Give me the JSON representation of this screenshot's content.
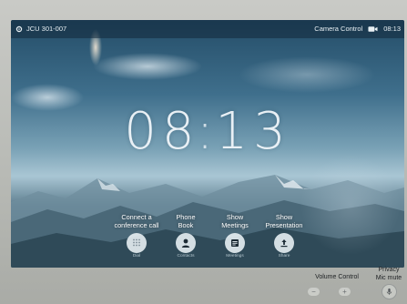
{
  "topbar": {
    "room_name": "JCU 301-007",
    "camera_control_label": "Camera Control",
    "time": "08:13"
  },
  "clock": {
    "hours": "08",
    "separator": ":",
    "minutes": "13"
  },
  "actions": [
    {
      "label": "Connect a\nconference call",
      "sub": "Dial",
      "icon": "dialpad-icon"
    },
    {
      "label": "Phone\nBook",
      "sub": "Contacts",
      "icon": "person-icon"
    },
    {
      "label": "Show\nMeetings",
      "sub": "Meetings",
      "icon": "calendar-icon"
    },
    {
      "label": "Show\nPresentation",
      "sub": "Share",
      "icon": "share-icon"
    }
  ],
  "hardware": {
    "volume_label": "Volume Control",
    "privacy_label": "Privacy\nMic mute"
  },
  "colors": {
    "topbar_bg": "#12283a",
    "button_bg": "#ecf2f6",
    "bezel": "#b9bbb6"
  }
}
